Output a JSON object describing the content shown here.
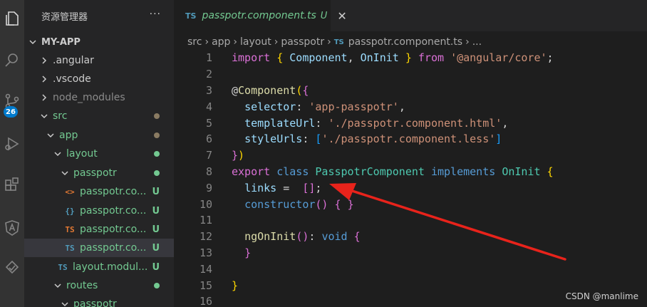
{
  "explorer": {
    "title": "资源管理器",
    "more": "···",
    "project": "MY-APP",
    "items": [
      {
        "label": ".angular"
      },
      {
        "label": ".vscode"
      },
      {
        "label": "node_modules"
      },
      {
        "label": "src"
      },
      {
        "label": "app"
      },
      {
        "label": "layout"
      },
      {
        "label": "passpotr"
      },
      {
        "label": "passpotr.co...",
        "icon": "<>",
        "status": "U"
      },
      {
        "label": "passpotr.co...",
        "icon": "{}",
        "status": "U"
      },
      {
        "label": "passpotr.co...",
        "icon": "TS",
        "status": "U"
      },
      {
        "label": "passpotr.co...",
        "icon": "TS",
        "status": "U"
      },
      {
        "label": "layout.modul...",
        "icon": "TS",
        "status": "U"
      },
      {
        "label": "routes"
      },
      {
        "label": "passpotr"
      }
    ]
  },
  "activity": {
    "badge": "26"
  },
  "tab": {
    "icon": "TS",
    "name": "passpotr.component.ts",
    "status": "U",
    "close": "✕"
  },
  "breadcrumb": {
    "parts": [
      "src",
      "app",
      "layout",
      "passpotr"
    ],
    "file_icon": "TS",
    "file": "passpotr.component.ts",
    "ellipsis": "..."
  },
  "code": {
    "line_numbers": [
      "1",
      "2",
      "3",
      "4",
      "5",
      "6",
      "7",
      "8",
      "9",
      "10",
      "11",
      "12",
      "13",
      "14",
      "15",
      "16"
    ]
  },
  "watermark": "CSDN @manlime",
  "colors": {
    "accent": "#007acc",
    "untracked": "#73c991",
    "arrow": "#e8231b"
  }
}
